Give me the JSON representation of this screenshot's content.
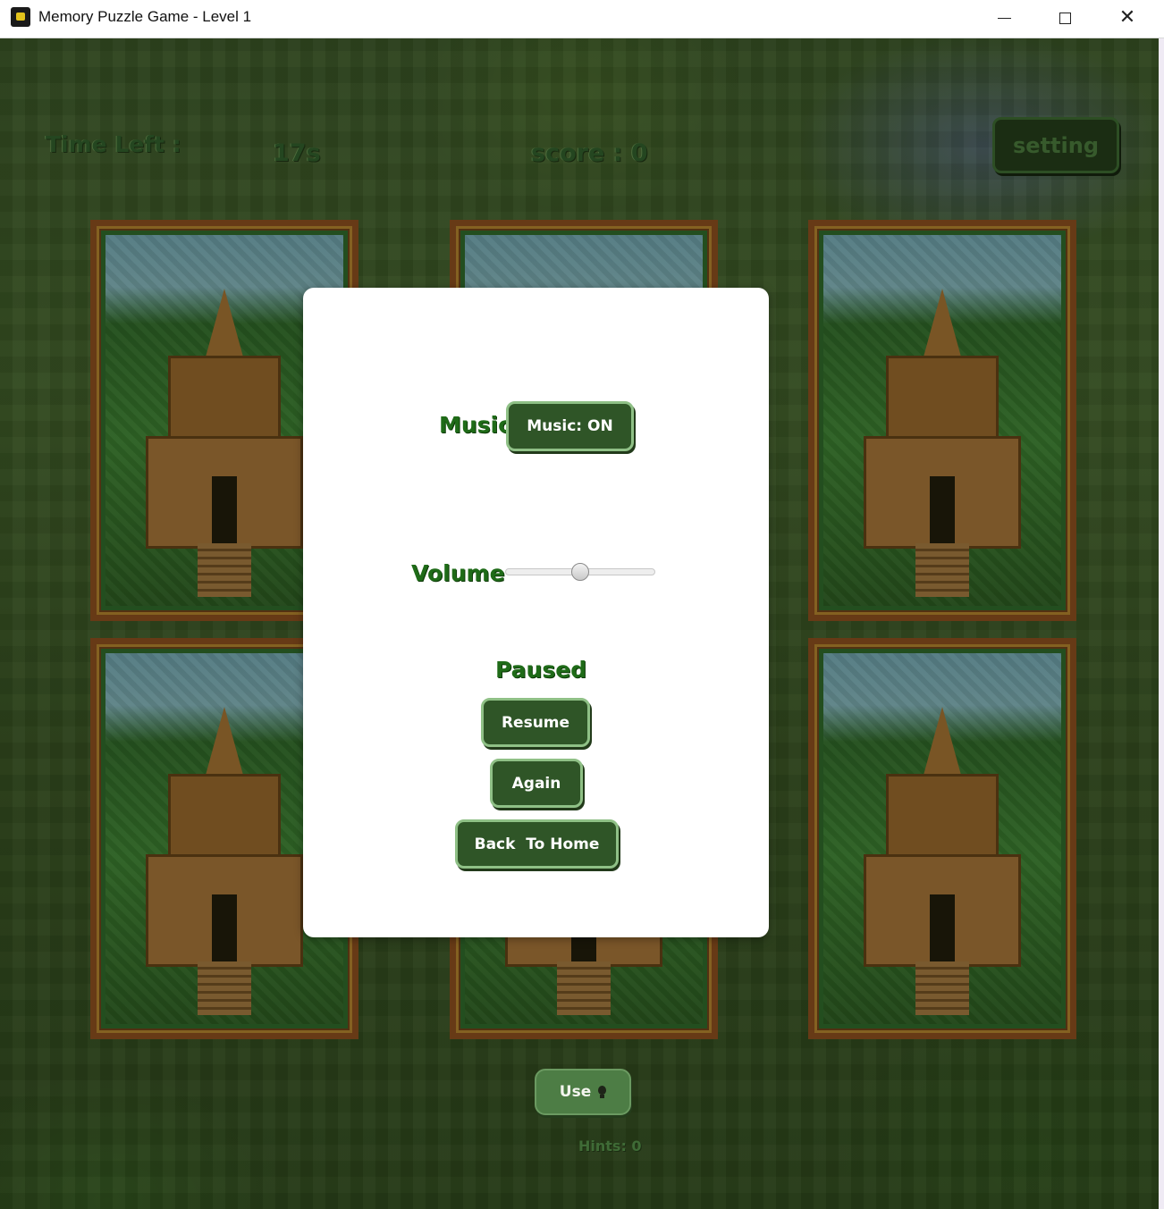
{
  "window": {
    "title": "Memory Puzzle Game - Level 1",
    "minimize_icon": "minimize-icon",
    "maximize_icon": "maximize-icon",
    "close_icon": "close-icon",
    "close_glyph": "✕"
  },
  "hud": {
    "time_label": "Time Left :",
    "time_value": "17s",
    "score": "score : 0",
    "setting_label": "setting"
  },
  "cards": [
    {
      "state": "face-down"
    },
    {
      "state": "face-down"
    },
    {
      "state": "face-down"
    },
    {
      "state": "face-down"
    },
    {
      "state": "face-down"
    },
    {
      "state": "face-down"
    }
  ],
  "hint": {
    "use_label": "Use",
    "icon": "lightbulb-icon",
    "count_text": "Hints: 0"
  },
  "settings_dialog": {
    "music_label": "Music",
    "music_button": "Music: ON",
    "volume_label": "Volume",
    "volume_level": 0.5,
    "status_label": "Paused",
    "resume_button": "Resume",
    "again_button": "Again",
    "home_button": "Back  To Home"
  },
  "colors": {
    "accent_green": "#2f5527",
    "label_green": "#1f6b18",
    "button_border": "#8fc086"
  }
}
